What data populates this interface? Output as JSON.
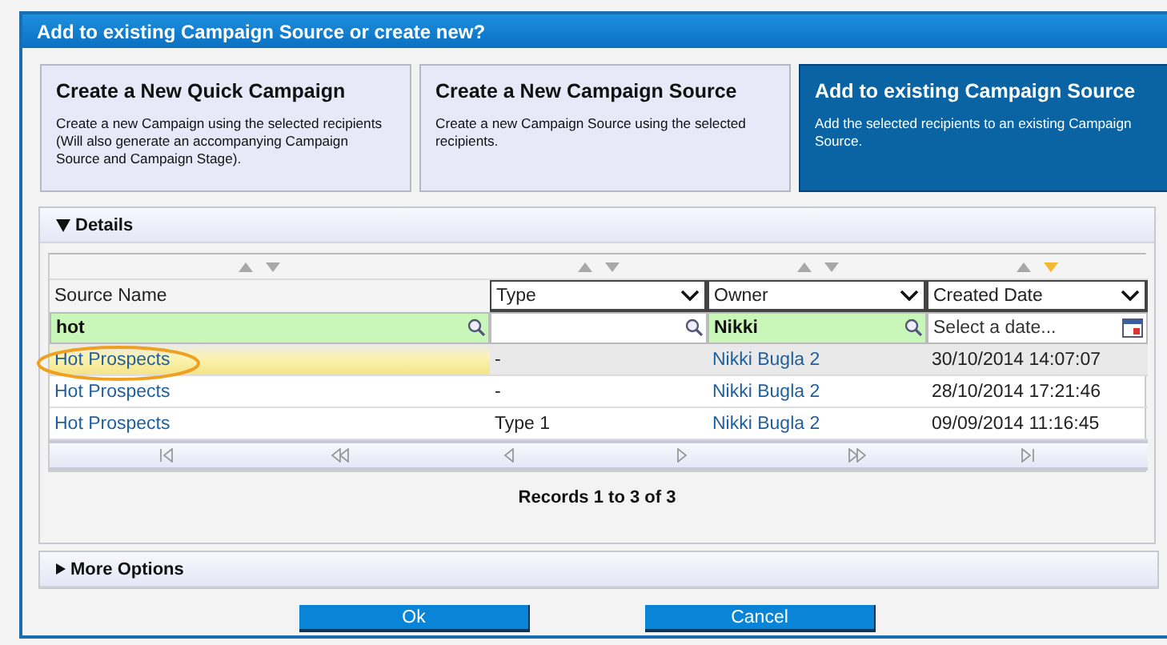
{
  "dialog": {
    "title": "Add to existing Campaign Source or create new?"
  },
  "cards": [
    {
      "title": "Create a New Quick Campaign",
      "description": "Create a new Campaign using the selected recipients (Will also generate an accompanying Campaign Source and Campaign Stage).",
      "selected": false
    },
    {
      "title": "Create a New Campaign Source",
      "description": "Create a new Campaign Source using the selected recipients.",
      "selected": false
    },
    {
      "title": "Add to existing Campaign Source",
      "description": "Add the selected recipients to an existing Campaign Source.",
      "selected": true
    }
  ],
  "details": {
    "title": "Details",
    "expanded": true,
    "columns": [
      {
        "label": "Source Name",
        "kind": "link",
        "dropdown": false,
        "sorted": false,
        "filter": {
          "kind": "text",
          "value": "hot"
        }
      },
      {
        "label": "Type",
        "kind": "text",
        "dropdown": true,
        "sorted": false,
        "filter": {
          "kind": "text"
        }
      },
      {
        "label": "Owner",
        "kind": "link",
        "dropdown": true,
        "sorted": false,
        "filter": {
          "kind": "text",
          "value": "Nikki"
        }
      },
      {
        "label": "Created Date",
        "kind": "text",
        "dropdown": true,
        "sorted": true,
        "filter": {
          "kind": "date",
          "placeholder": "Select a date..."
        }
      }
    ],
    "rows": [
      {
        "selected": true,
        "annotated": true,
        "cells": [
          "Hot Prospects",
          "-",
          "Nikki Bugla 2",
          "30/10/2014 14:07:07"
        ]
      },
      {
        "selected": false,
        "annotated": false,
        "cells": [
          "Hot Prospects",
          "-",
          "Nikki Bugla 2",
          "28/10/2014 17:21:46"
        ]
      },
      {
        "selected": false,
        "annotated": false,
        "cells": [
          "Hot Prospects",
          "Type 1",
          "Nikki Bugla 2",
          "09/09/2014 11:16:45"
        ]
      }
    ],
    "records": "Records 1 to 3 of 3"
  },
  "more_options": {
    "title": "More Options",
    "expanded": false
  },
  "buttons": [
    "Ok",
    "Cancel"
  ]
}
